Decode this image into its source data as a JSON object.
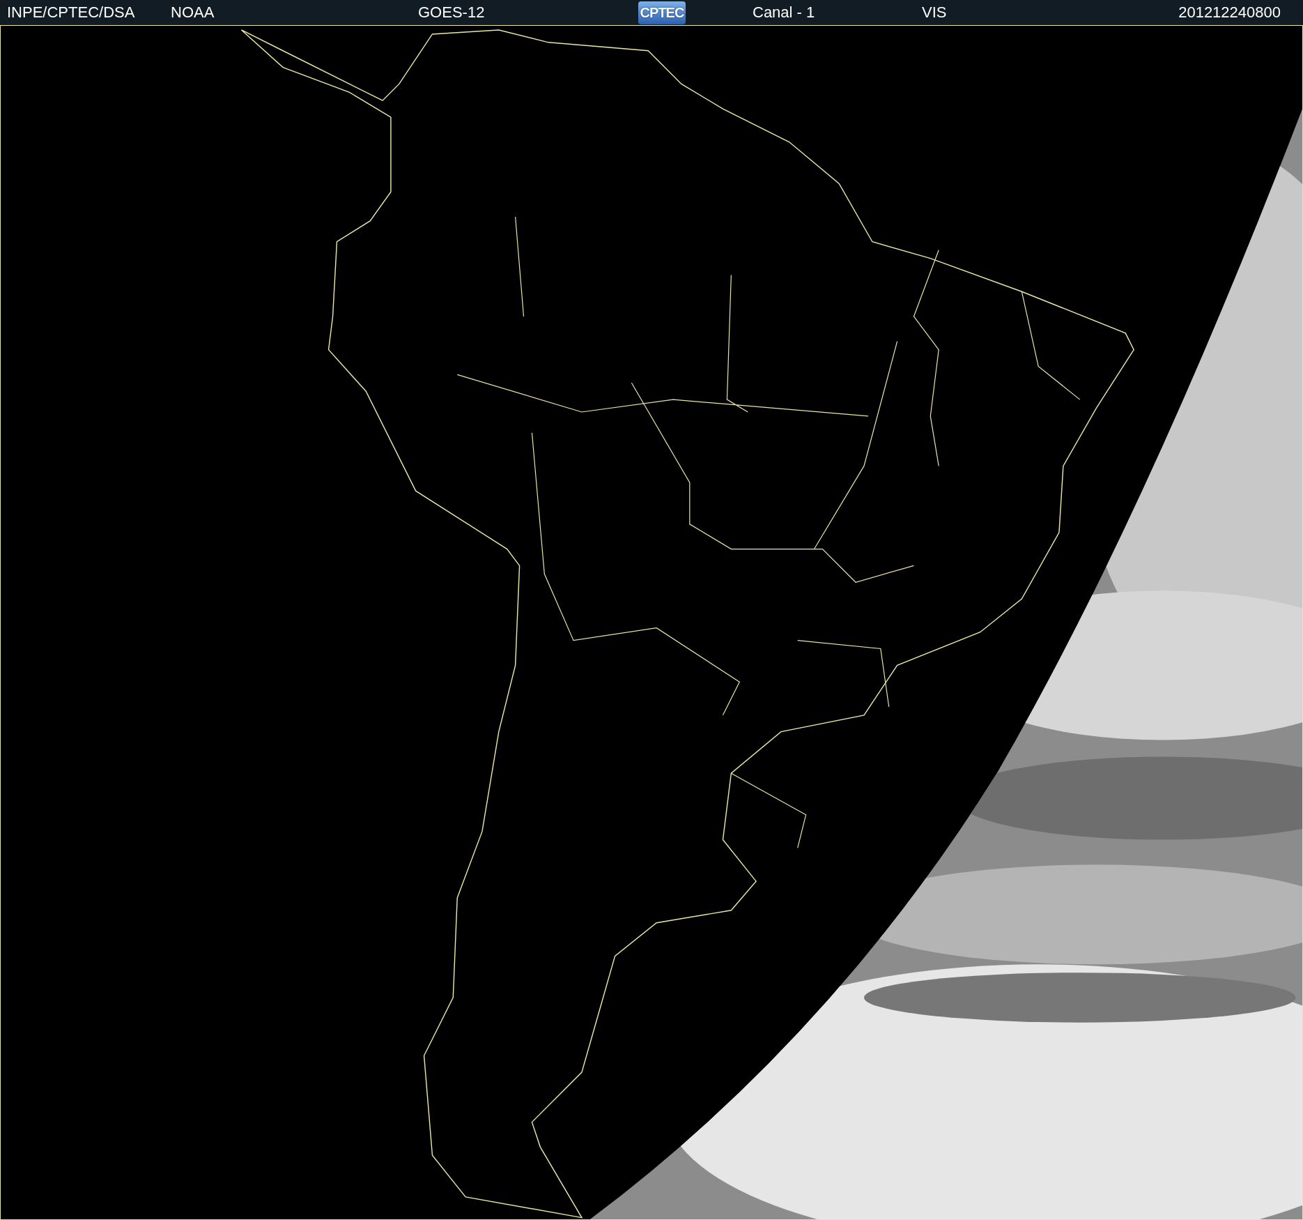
{
  "header": {
    "agency": "INPE/CPTEC/DSA",
    "source": "NOAA",
    "satellite": "GOES-12",
    "logo": "CPTEC",
    "channel": "Canal - 1",
    "band": "VIS",
    "timestamp": "201212240800"
  }
}
